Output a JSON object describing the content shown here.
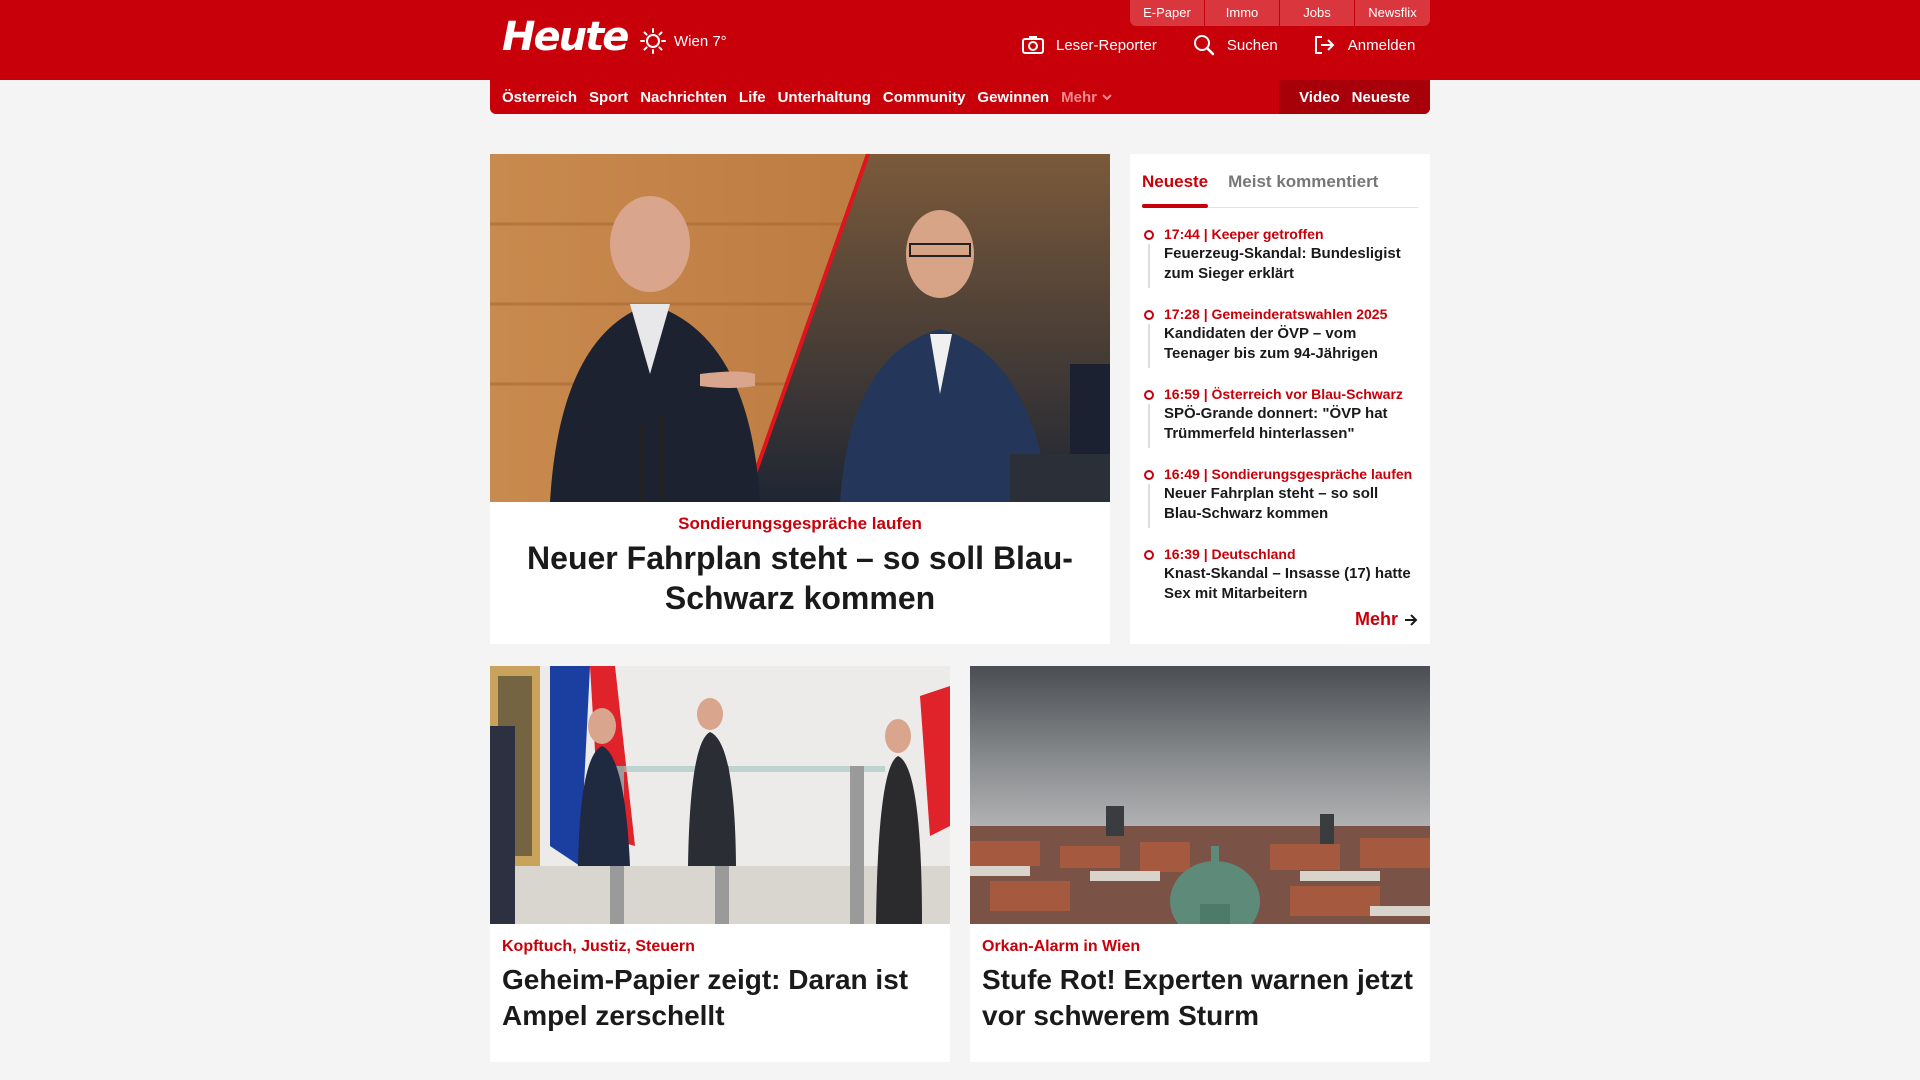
{
  "topbar": {
    "links": [
      "E-Paper",
      "Immo",
      "Jobs",
      "Newsflix"
    ]
  },
  "header": {
    "logo": "Heute",
    "weather": "Wien 7°",
    "reporter": "Leser-Reporter",
    "search": "Suchen",
    "login": "Anmelden"
  },
  "nav": {
    "items": [
      "Österreich",
      "Sport",
      "Nachrichten",
      "Life",
      "Unterhaltung",
      "Community",
      "Gewinnen"
    ],
    "more": "Mehr",
    "video": "Video",
    "latest": "Neueste"
  },
  "hero": {
    "kicker": "Sondierungsgespräche laufen",
    "title": "Neuer Fahrplan steht – so soll Blau-Schwarz kommen"
  },
  "sidebar": {
    "tabs": [
      "Neueste",
      "Meist kommentiert"
    ],
    "items": [
      {
        "meta": "17:44 | Keeper getroffen",
        "headline": "Feuerzeug-Skandal: Bundesligist zum Sieger erklärt"
      },
      {
        "meta": "17:28 | Gemeinderatswahlen 2025",
        "headline": "Kandidaten der ÖVP – vom Teenager bis zum 94-Jährigen"
      },
      {
        "meta": "16:59 | Österreich vor Blau-Schwarz",
        "headline": "SPÖ-Grande donnert: \"ÖVP hat Trümmerfeld hinterlassen\""
      },
      {
        "meta": "16:49 | Sondierungsgespräche laufen",
        "headline": "Neuer Fahrplan steht – so soll Blau-Schwarz kommen"
      },
      {
        "meta": "16:39 | Deutschland",
        "headline": "Knast-Skandal – Insasse (17) hatte Sex mit Mitarbeitern"
      }
    ],
    "more": "Mehr"
  },
  "cards": [
    {
      "kicker": "Kopftuch, Justiz, Steuern",
      "title": "Geheim-Papier zeigt: Daran ist Ampel zerschellt"
    },
    {
      "kicker": "Orkan-Alarm in Wien",
      "title": "Stufe Rot! Experten warnen jetzt vor schwerem Sturm"
    }
  ],
  "colors": {
    "brand": "#c8000a"
  }
}
